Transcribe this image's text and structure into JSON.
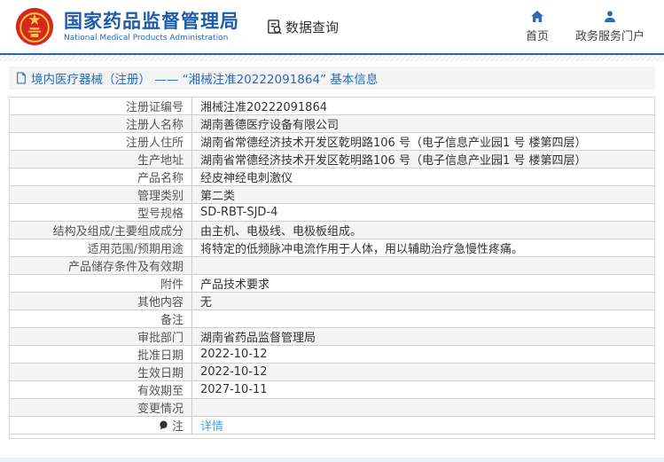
{
  "header": {
    "logo_title": "国家药品监督管理局",
    "logo_subtitle": "National Medical Products Administration",
    "logo_icon": "china-national-emblem",
    "data_query": {
      "label": "数据查询",
      "icon": "document-search-icon"
    },
    "nav": [
      {
        "label": "首页",
        "icon": "home-icon"
      },
      {
        "label": "政务服务门户",
        "icon": "user-icon"
      }
    ]
  },
  "title_bar": {
    "icon": "document-icon",
    "text": "境内医疗器械（注册） —— “湘械注准20222091864” 基本信息"
  },
  "table": {
    "rows": [
      {
        "label": "注册证编号",
        "value": "湘械注准20222091864"
      },
      {
        "label": "注册人名称",
        "value": "湖南善德医疗设备有限公司"
      },
      {
        "label": "注册人住所",
        "value": "湖南省常德经济技术开发区乾明路106 号（电子信息产业园1 号 楼第四层）"
      },
      {
        "label": "生产地址",
        "value": "湖南省常德经济技术开发区乾明路106 号（电子信息产业园1 号 楼第四层）"
      },
      {
        "label": "产品名称",
        "value": "经皮神经电刺激仪"
      },
      {
        "label": "管理类别",
        "value": "第二类"
      },
      {
        "label": "型号规格",
        "value": "SD-RBT-SJD-4"
      },
      {
        "label": "结构及组成/主要组成成分",
        "value": "由主机、电极线、电极板组成。"
      },
      {
        "label": "适用范围/预期用途",
        "value": "将特定的低频脉冲电流作用于人体，用以辅助治疗急慢性疼痛。"
      },
      {
        "label": "产品储存条件及有效期",
        "value": ""
      },
      {
        "label": "附件",
        "value": "产品技术要求"
      },
      {
        "label": "其他内容",
        "value": "无"
      },
      {
        "label": "备注",
        "value": ""
      },
      {
        "label": "审批部门",
        "value": "湖南省药品监督管理局"
      },
      {
        "label": "批准日期",
        "value": "2022-10-12"
      },
      {
        "label": "生效日期",
        "value": "2022-10-12"
      },
      {
        "label": "有效期至",
        "value": "2027-10-11"
      },
      {
        "label": "变更情况",
        "value": ""
      },
      {
        "label": "注",
        "value": "详情",
        "is_link": true,
        "has_icon": true,
        "icon": "note-balloon-icon"
      }
    ]
  },
  "colors": {
    "brand_blue": "#1d5ca9",
    "header_border_blue": "#2a67ad",
    "title_text_blue": "#2a6cb3",
    "link_blue": "#4da3e8",
    "nav_icon_blue": "#2d6cb5",
    "row_alt_gray": "#f5f5f5",
    "emblem_red": "#d7281e",
    "emblem_gold": "#f7c948"
  }
}
